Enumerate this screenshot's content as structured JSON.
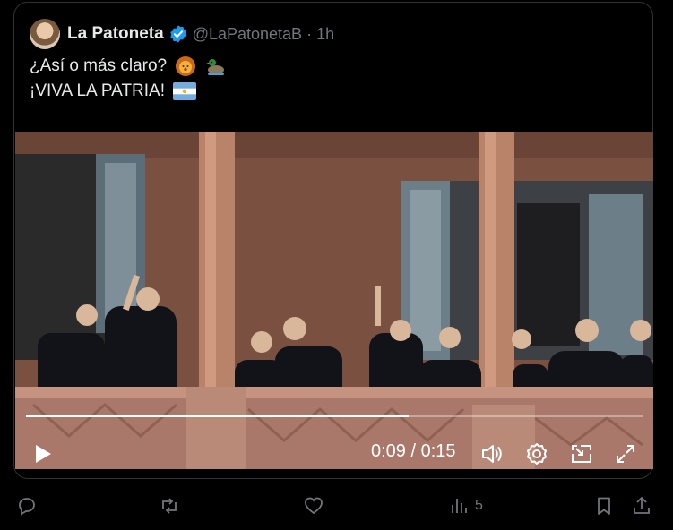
{
  "post": {
    "author_name": "La Patoneta",
    "author_handle": "@LaPatonetaB",
    "separator": "·",
    "time": "1h",
    "line1": "¿Así o más claro?",
    "line1_emojis": [
      "lion-emoji",
      "duck-emoji"
    ],
    "line2": "¡VIVA LA PATRIA!",
    "line2_emoji": "argentina-flag-emoji",
    "verified_color": "#1d9bf0"
  },
  "video": {
    "timecode": "0:09 / 0:15",
    "progress": 0.62
  },
  "actions": {
    "reply_count": "",
    "repost_count": "",
    "like_count": "",
    "views_count": "5"
  },
  "colors": {
    "text_primary": "#e7e9ea",
    "text_secondary": "#71767b",
    "border": "#2f3336"
  }
}
